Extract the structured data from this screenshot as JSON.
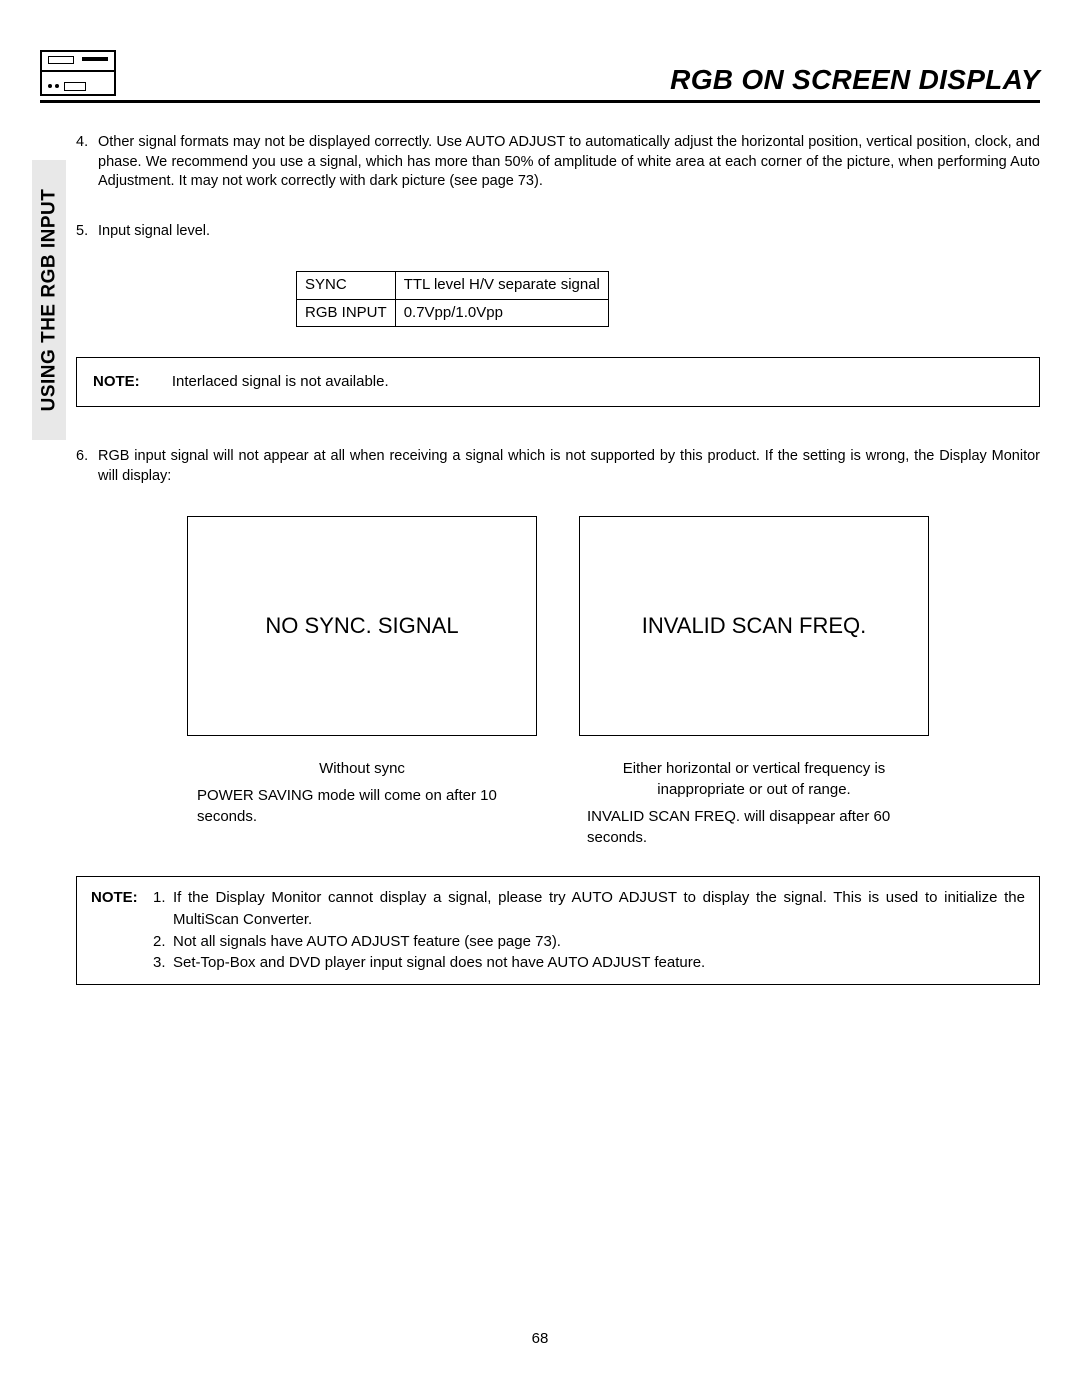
{
  "header": {
    "title": "RGB ON SCREEN DISPLAY"
  },
  "sidetab": {
    "label": "USING THE RGB INPUT"
  },
  "list": {
    "item4": {
      "num": "4.",
      "text": "Other signal formats may not be displayed correctly.  Use AUTO ADJUST to automatically adjust the horizontal position, vertical position, clock, and phase.   We recommend you use a signal, which has more than 50% of amplitude of white area at each corner of the picture, when performing Auto Adjustment.  It may not work correctly with dark picture (see page 73)."
    },
    "item5": {
      "num": "5.",
      "text": "Input signal level."
    },
    "item6": {
      "num": "6.",
      "text": "RGB input signal will not appear at all when receiving a signal which is not supported by this product. If the setting is wrong, the Display Monitor will display:"
    }
  },
  "sigtable": {
    "r1c1": "SYNC",
    "r1c2": "TTL level H/V separate signal",
    "r2c1": "RGB INPUT",
    "r2c2": "0.7Vpp/1.0Vpp"
  },
  "note1": {
    "label": "NOTE:",
    "text": "Interlaced signal is not available."
  },
  "display": {
    "left": {
      "box": "NO SYNC. SIGNAL",
      "cap1": "Without sync",
      "cap2": "POWER SAVING mode will come on after 10 seconds."
    },
    "right": {
      "box": "INVALID SCAN FREQ.",
      "cap1": "Either horizontal or vertical frequency is inappropriate or out of range.",
      "cap2": "INVALID SCAN FREQ. will disappear after 60 seconds."
    }
  },
  "note2": {
    "label": "NOTE:",
    "i1num": "1.",
    "i1": "If the Display Monitor cannot display a signal, please try AUTO ADJUST to display the signal.  This is used to initialize the MultiScan Converter.",
    "i2num": "2.",
    "i2": "Not all signals have AUTO ADJUST feature (see page 73).",
    "i3num": "3.",
    "i3": "Set-Top-Box and DVD player input signal does not have AUTO ADJUST feature."
  },
  "pagenum": "68"
}
